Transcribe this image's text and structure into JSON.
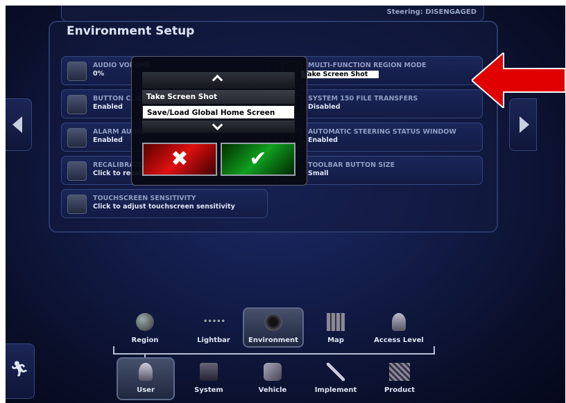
{
  "header": {
    "steering_status": "Steering: DISENGAGED"
  },
  "panel": {
    "title": "Environment Setup"
  },
  "settings": [
    {
      "label": "AUDIO VOLUME",
      "value": "0%"
    },
    {
      "label": "BUTTON CLICK",
      "value": "Enabled"
    },
    {
      "label": "ALARM AUDIO",
      "value": "Enabled"
    },
    {
      "label": "RECALIBRATE TOUCHSCREEN",
      "value": "Click to recalibrate the touchscreen"
    },
    {
      "label": "TOUCHSCREEN SENSITIVITY",
      "value": "Click to adjust touchscreen sensitivity"
    },
    {
      "label": "MULTI-FUNCTION REGION MODE",
      "value": "Take Screen Shot"
    },
    {
      "label": "SYSTEM 150 FILE TRANSFERS",
      "value": "Disabled"
    },
    {
      "label": "AUTOMATIC STEERING STATUS WINDOW",
      "value": "Enabled"
    },
    {
      "label": "TOOLBAR BUTTON SIZE",
      "value": "Small"
    }
  ],
  "popup": {
    "options": [
      "Take Screen Shot",
      "Save/Load Global Home Screen"
    ],
    "selected_index": 1,
    "cancel_symbol": "✖",
    "confirm_symbol": "✔"
  },
  "tabs_upper": [
    {
      "label": "Region",
      "icon": "globe-icon"
    },
    {
      "label": "Lightbar",
      "icon": "lightbar-icon"
    },
    {
      "label": "Environment",
      "icon": "speaker-icon",
      "selected": true
    },
    {
      "label": "Map",
      "icon": "map-icon"
    },
    {
      "label": "Access Level",
      "icon": "person-icon"
    }
  ],
  "tabs_lower": [
    {
      "label": "User",
      "icon": "user-icon",
      "selected": true
    },
    {
      "label": "System",
      "icon": "system-icon"
    },
    {
      "label": "Vehicle",
      "icon": "vehicle-icon"
    },
    {
      "label": "Implement",
      "icon": "implement-icon"
    },
    {
      "label": "Product",
      "icon": "product-icon"
    }
  ],
  "colors": {
    "annotation_arrow": "#e00000",
    "selected_option": "#ffffff",
    "background": "#121c48"
  }
}
